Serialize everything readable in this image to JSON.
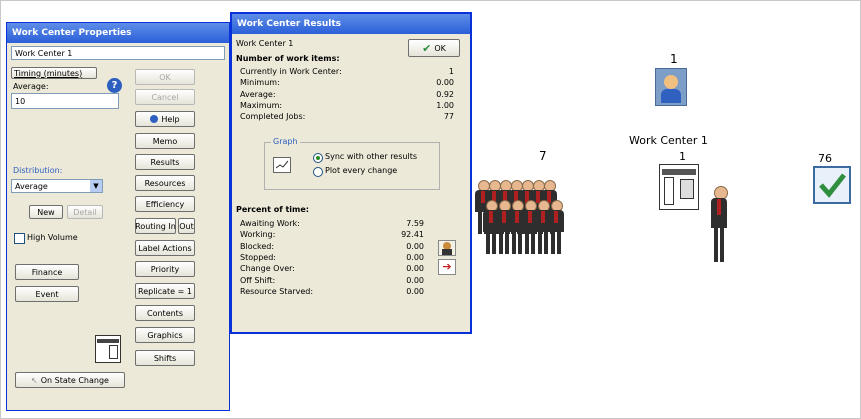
{
  "props": {
    "title": "Work Center Properties",
    "name_value": "Work Center 1",
    "timing_button": "Timing (minutes)",
    "average_label": "Average:",
    "average_value": "10",
    "ok": "OK",
    "cancel": "Cancel",
    "help": "Help",
    "memo": "Memo",
    "results": "Results",
    "resources": "Resources",
    "efficiency": "Efficiency",
    "routing_in": "Routing In",
    "out": "Out",
    "label_actions": "Label Actions",
    "priority": "Priority",
    "replicate": "Replicate = 1",
    "contents": "Contents",
    "graphics": "Graphics",
    "shifts": "Shifts",
    "distribution_label": "Distribution:",
    "distribution_value": "Average",
    "new": "New",
    "detail": "Detail",
    "high_volume": "High Volume",
    "finance": "Finance",
    "event": "Event",
    "on_state_change": "On State Change"
  },
  "results": {
    "title": "Work Center Results",
    "name": "Work Center 1",
    "ok": "OK",
    "work_items_heading": "Number of work items:",
    "work_items": [
      {
        "label": "Currently in Work Center:",
        "value": "1"
      },
      {
        "label": "Minimum:",
        "value": "0.00"
      },
      {
        "label": "Average:",
        "value": "0.92"
      },
      {
        "label": "Maximum:",
        "value": "1.00"
      },
      {
        "label": "Completed Jobs:",
        "value": "77"
      }
    ],
    "graph_label": "Graph",
    "sync_option": "Sync with other results",
    "plot_option": "Plot every change",
    "percent_heading": "Percent of time:",
    "percent": [
      {
        "label": "Awaiting Work:",
        "value": "7.59"
      },
      {
        "label": "Working:",
        "value": "92.41"
      },
      {
        "label": "Blocked:",
        "value": "0.00"
      },
      {
        "label": "Stopped:",
        "value": "0.00"
      },
      {
        "label": "Change Over:",
        "value": "0.00"
      },
      {
        "label": "Off Shift:",
        "value": "0.00"
      },
      {
        "label": "Resource Starved:",
        "value": "0.00"
      }
    ]
  },
  "canvas": {
    "queue_count": "7",
    "entry_count": "1",
    "wc_label": "Work Center 1",
    "wc_count": "1",
    "exit_count": "76"
  },
  "colors": {
    "accent": "#2a5fd8",
    "check": "#2f8f3f"
  }
}
